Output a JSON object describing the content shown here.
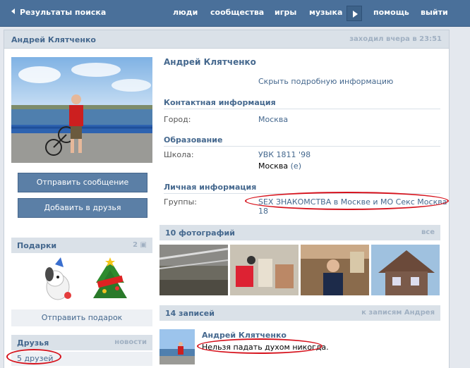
{
  "topbar": {
    "back_label": "Результаты поиска",
    "nav": [
      "люди",
      "сообщества",
      "игры",
      "музыка",
      "помощь",
      "выйти"
    ]
  },
  "profile": {
    "name": "Андрей Клятченко",
    "last_seen": "заходил вчера в 23:51",
    "hide_info": "Скрыть подробную информацию",
    "contact": {
      "title": "Контактная информация",
      "city_label": "Город:",
      "city_value": "Москва"
    },
    "education": {
      "title": "Образование",
      "school_label": "Школа:",
      "school_value": "УВК 1811 '98",
      "school_city": "Москва",
      "school_city_suffix": "(е)"
    },
    "personal": {
      "title": "Личная информация",
      "groups_label": "Группы:",
      "groups_value": "SEX ЗНАКОМСТВА в Москве и МО Секс Москва 18"
    }
  },
  "actions": {
    "send_message": "Отправить сообщение",
    "add_friend": "Добавить в друзья"
  },
  "gifts": {
    "title": "Подарки",
    "count": "2",
    "send_gift": "Отправить подарок"
  },
  "friends": {
    "title": "Друзья",
    "news_link": "новости",
    "count_label": "5 друзей"
  },
  "photos": {
    "title": "10 фотографий",
    "all_link": "все"
  },
  "wall": {
    "title": "14 записей",
    "to_wall_link": "к записям Андрея",
    "post_author": "Андрей Клятченко",
    "post_text": "Нельзя падать духом никогда."
  },
  "colors": {
    "topbar": "#4a709a",
    "link": "#45688e",
    "highlight_oval": "#d6121c"
  }
}
